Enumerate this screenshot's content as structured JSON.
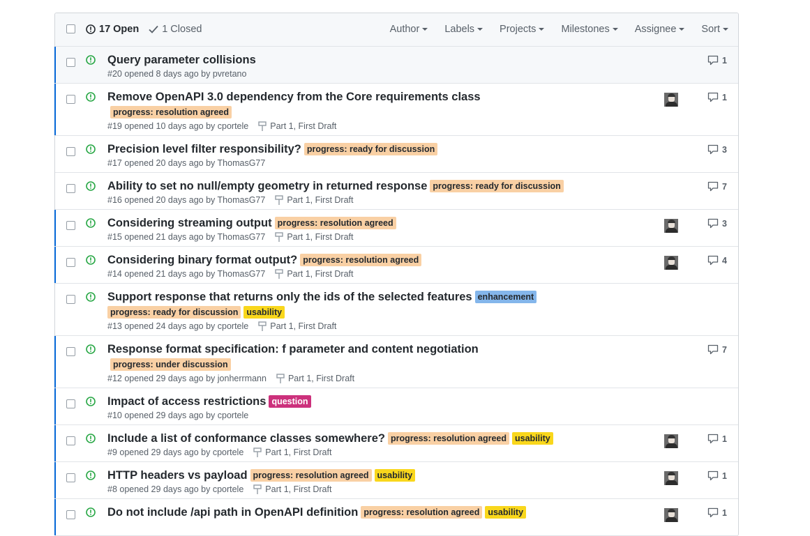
{
  "header": {
    "open_label": "17 Open",
    "closed_label": "1 Closed",
    "filters": [
      "Author",
      "Labels",
      "Projects",
      "Milestones",
      "Assignee",
      "Sort"
    ]
  },
  "colors": {
    "label_resolution": "#f9d0a4",
    "label_discussion": "#f9d0a4",
    "label_usability": "#f9d71c",
    "label_enhancement": "#84b6eb",
    "label_question": "#cc317c"
  },
  "issues": [
    {
      "title": "Query parameter collisions",
      "meta": "#20 opened 8 days ago by pvretano",
      "labels": [],
      "milestone": "",
      "comments": "1",
      "avatar": false
    },
    {
      "title": "Remove OpenAPI 3.0 dependency from the Core requirements class",
      "meta": "#19 opened 10 days ago by cportele",
      "labels": [
        "progress: resolution agreed"
      ],
      "milestone": "Part 1, First Draft",
      "comments": "1",
      "avatar": true
    },
    {
      "title": "Precision level filter responsibility?",
      "meta": "#17 opened 20 days ago by ThomasG77",
      "labels": [
        "progress: ready for discussion"
      ],
      "milestone": "",
      "comments": "3",
      "avatar": false
    },
    {
      "title": "Ability to set no null/empty geometry in returned response",
      "meta": "#16 opened 20 days ago by ThomasG77",
      "labels": [
        "progress: ready for discussion"
      ],
      "milestone": "Part 1, First Draft",
      "comments": "7",
      "avatar": false
    },
    {
      "title": "Considering streaming output",
      "meta": "#15 opened 21 days ago by ThomasG77",
      "labels": [
        "progress: resolution agreed"
      ],
      "milestone": "Part 1, First Draft",
      "comments": "3",
      "avatar": true
    },
    {
      "title": "Considering binary format output?",
      "meta": "#14 opened 21 days ago by ThomasG77",
      "labels": [
        "progress: resolution agreed"
      ],
      "milestone": "Part 1, First Draft",
      "comments": "4",
      "avatar": true
    },
    {
      "title": "Support response that returns only the ids of the selected features",
      "meta": "#13 opened 24 days ago by cportele",
      "labels": [
        "enhancement",
        "progress: ready for discussion",
        "usability"
      ],
      "milestone": "Part 1, First Draft",
      "comments": "",
      "avatar": false
    },
    {
      "title": "Response format specification: f parameter and content negotiation",
      "meta": "#12 opened 29 days ago by jonherrmann",
      "labels": [
        "progress: under discussion"
      ],
      "milestone": "Part 1, First Draft",
      "comments": "7",
      "avatar": false
    },
    {
      "title": "Impact of access restrictions",
      "meta": "#10 opened 29 days ago by cportele",
      "labels": [
        "question"
      ],
      "milestone": "",
      "comments": "",
      "avatar": false
    },
    {
      "title": "Include a list of conformance classes somewhere?",
      "meta": "#9 opened 29 days ago by cportele",
      "labels": [
        "progress: resolution agreed",
        "usability"
      ],
      "milestone": "Part 1, First Draft",
      "comments": "1",
      "avatar": true
    },
    {
      "title": "HTTP headers vs payload",
      "meta": "#8 opened 29 days ago by cportele",
      "labels": [
        "progress: resolution agreed",
        "usability"
      ],
      "milestone": "Part 1, First Draft",
      "comments": "1",
      "avatar": true
    },
    {
      "title": "Do not include /api path in OpenAPI definition",
      "meta": "",
      "labels": [
        "progress: resolution agreed",
        "usability"
      ],
      "milestone": "",
      "comments": "1",
      "avatar": true
    }
  ]
}
